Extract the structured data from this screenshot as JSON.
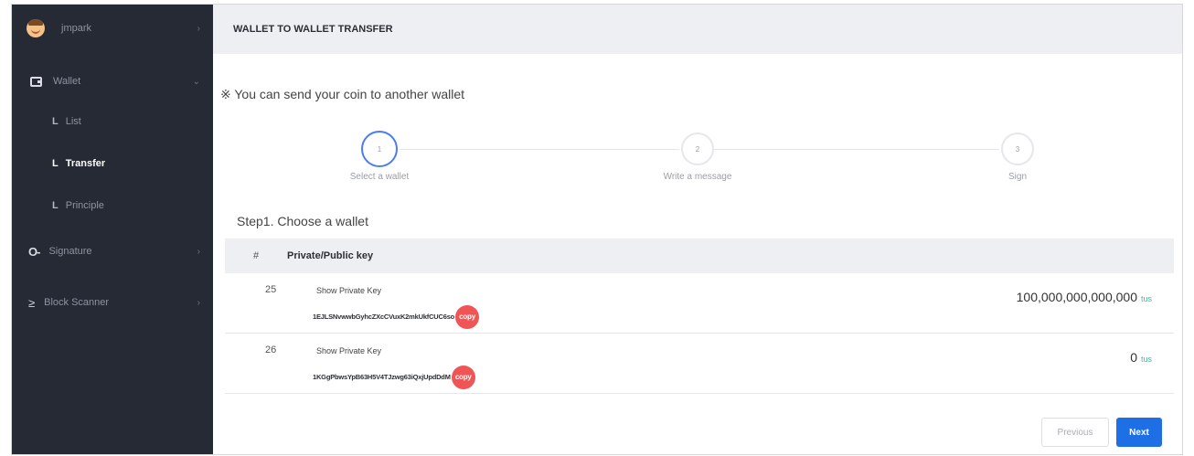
{
  "sidebar": {
    "user": {
      "name": "jmpark",
      "icon": "avatar"
    },
    "wallet": {
      "label": "Wallet",
      "icon": "wallet-icon"
    },
    "wallet_sub": [
      {
        "prefix": "L",
        "label": "List"
      },
      {
        "prefix": "L",
        "label": "Transfer",
        "active": true
      },
      {
        "prefix": "L",
        "label": "Principle"
      }
    ],
    "signature": {
      "label": "Signature",
      "icon": "key-icon"
    },
    "block_scanner": {
      "label": "Block Scanner",
      "icon": "scanner-icon"
    }
  },
  "header": {
    "title": "WALLET TO WALLET TRANSFER"
  },
  "notice": "※ You can send your coin to another wallet",
  "steps": [
    {
      "num": "1",
      "label": "Select a wallet",
      "active": true
    },
    {
      "num": "2",
      "label": "Write a message"
    },
    {
      "num": "3",
      "label": "Sign"
    }
  ],
  "step_title": "Step1. Choose a wallet",
  "table": {
    "headers": [
      "#",
      "Private/Public key"
    ],
    "rows": [
      {
        "num": "25",
        "show_label": "Show Private Key",
        "key": "1EJLSNvwwbGyhcZXcCVuxK2mkUkfCUC6so",
        "copy": "copy",
        "amount": "100,000,000,000,000",
        "unit": "tus"
      },
      {
        "num": "26",
        "show_label": "Show Private Key",
        "key": "1KGgPbwsYpB63H5V4TJzwg63iQxjUpdDdM",
        "copy": "copy",
        "amount": "0",
        "unit": "tus"
      }
    ]
  },
  "buttons": {
    "previous": "Previous",
    "next": "Next"
  },
  "colors": {
    "sidebar_bg": "#252a35",
    "accent": "#1e6fe6",
    "copy": "#f05454",
    "unit": "#2ec4a2"
  }
}
